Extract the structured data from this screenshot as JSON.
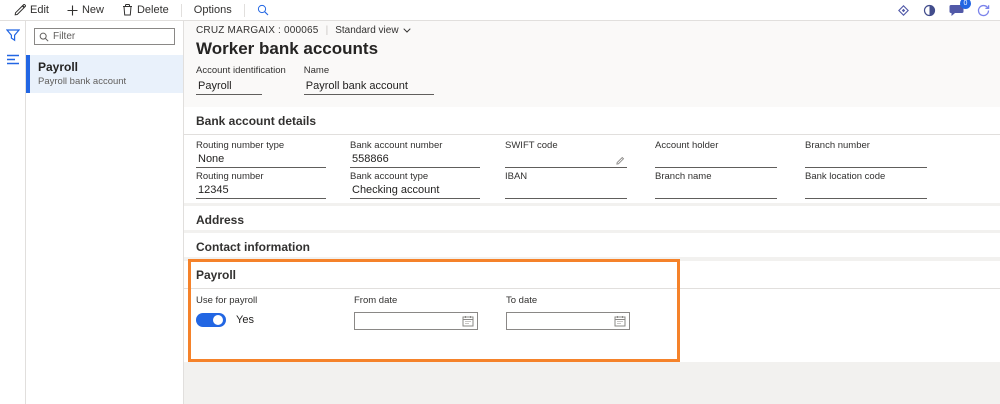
{
  "toolbar": {
    "edit_label": "Edit",
    "new_label": "New",
    "delete_label": "Delete",
    "options_label": "Options",
    "badge_count": "0"
  },
  "nav": {
    "filter_placeholder": "Filter",
    "items": [
      {
        "title": "Payroll",
        "subtitle": "Payroll bank account",
        "selected": true
      }
    ]
  },
  "header": {
    "record_id": "CRUZ MARGAIX : 000065",
    "separator": "|",
    "view_selector": "Standard view",
    "page_title": "Worker bank accounts",
    "fields": [
      {
        "label": "Account identification",
        "value": "Payroll"
      },
      {
        "label": "Name",
        "value": "Payroll bank account"
      }
    ]
  },
  "sections": {
    "bank_details": {
      "title": "Bank account details",
      "fields": [
        {
          "label": "Routing number type",
          "value": "None"
        },
        {
          "label": "Bank account number",
          "value": "558866"
        },
        {
          "label": "SWIFT code",
          "value": ""
        },
        {
          "label": "Account holder",
          "value": ""
        },
        {
          "label": "Branch number",
          "value": ""
        },
        {
          "label": "Routing number",
          "value": "12345"
        },
        {
          "label": "Bank account type",
          "value": "Checking account"
        },
        {
          "label": "IBAN",
          "value": ""
        },
        {
          "label": "Branch name",
          "value": ""
        },
        {
          "label": "Bank location code",
          "value": ""
        }
      ]
    },
    "address": {
      "title": "Address"
    },
    "contact": {
      "title": "Contact information"
    },
    "payroll": {
      "title": "Payroll",
      "use_for_payroll_label": "Use for payroll",
      "toggle_state": "Yes",
      "from_date_label": "From date",
      "from_date_value": "",
      "to_date_label": "To date",
      "to_date_value": ""
    }
  },
  "icons": {
    "toolbar_left": [
      "edit-pencil",
      "add-plus",
      "delete-trash",
      "search-magnifier"
    ],
    "toolbar_right": [
      "diamond",
      "contrast-circle",
      "messages-bubble",
      "refresh-arrow"
    ],
    "side_strip": [
      "filter-funnel",
      "list-hamburger"
    ],
    "field_icons": [
      "edit-pencil-small",
      "calendar"
    ]
  },
  "colors": {
    "accent_blue": "#2266E3",
    "highlight_orange": "#F5822A",
    "selected_item_bg": "#E9F1FB",
    "header_bg": "#FAF9F8",
    "workspace_bg": "#F2F1EF"
  }
}
